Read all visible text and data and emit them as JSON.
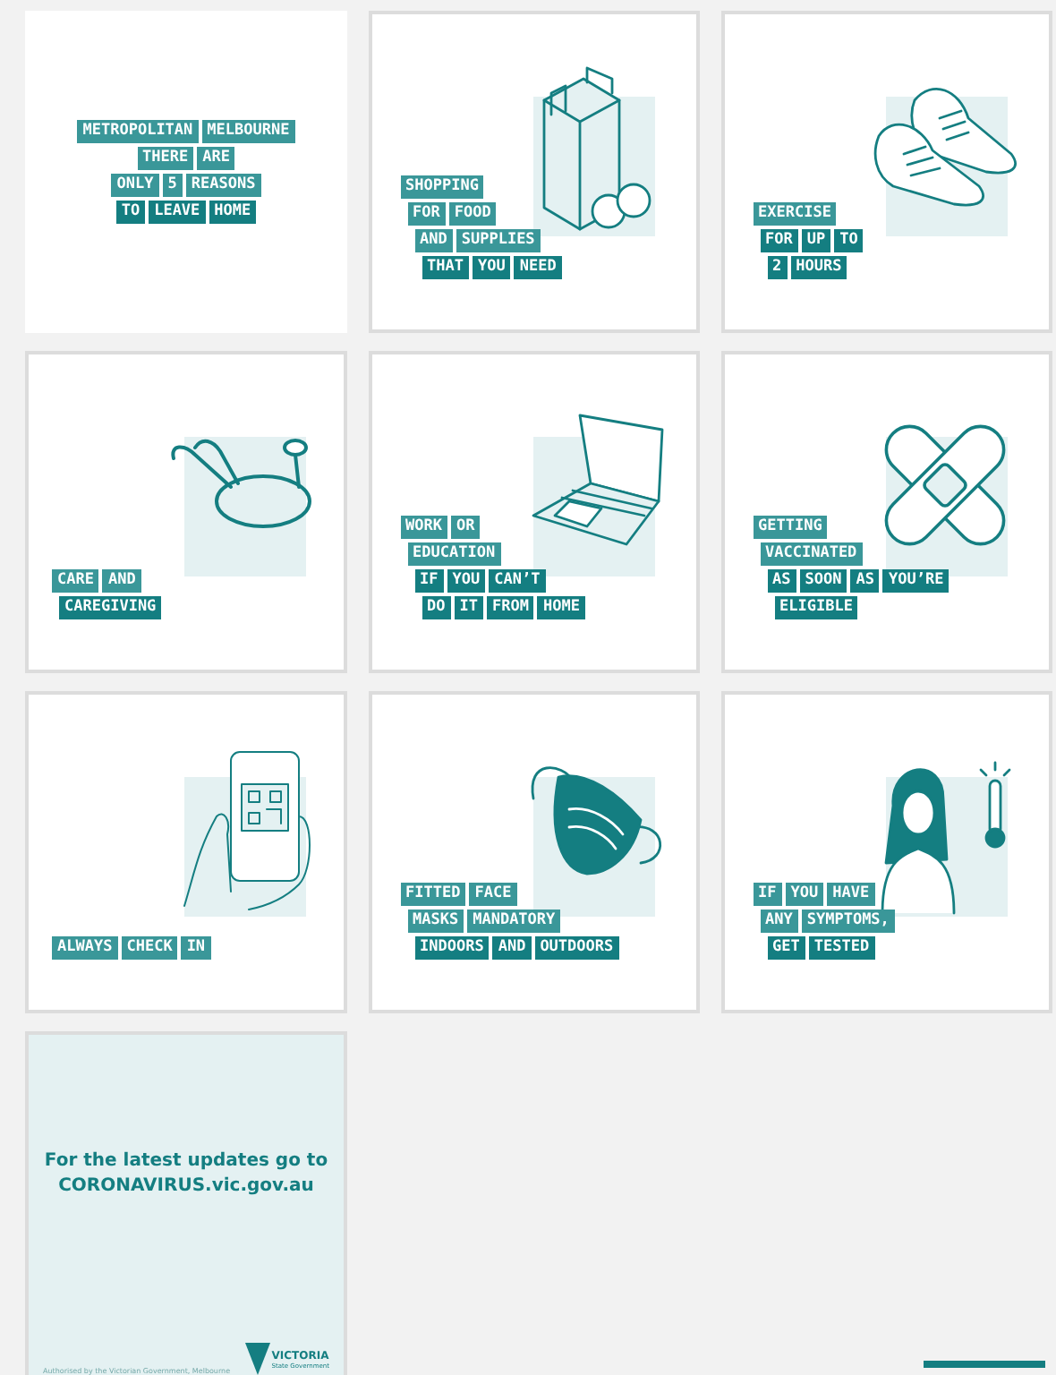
{
  "tiles": [
    {
      "kind": "text",
      "framed": false,
      "lines": [
        {
          "color": "#3a9799",
          "words": [
            "METROPOLITAN",
            "MELBOURNE"
          ]
        },
        {
          "color": "#3a9799",
          "words": [
            "THERE",
            "ARE"
          ]
        },
        {
          "color": "#3a9799",
          "words": [
            "ONLY",
            "5",
            "REASONS"
          ]
        },
        {
          "color": "#147e81",
          "words": [
            "TO",
            "LEAVE",
            "HOME"
          ]
        }
      ]
    },
    {
      "kind": "bag",
      "framed": true,
      "lines": [
        {
          "color": "#3a9799",
          "words": [
            "SHOPPING"
          ]
        },
        {
          "color": "#3a9799",
          "words": [
            "FOR",
            "FOOD"
          ]
        },
        {
          "color": "#3a9799",
          "words": [
            "AND",
            "SUPPLIES"
          ]
        },
        {
          "color": "#147e81",
          "words": [
            "THAT",
            "YOU",
            "NEED"
          ]
        }
      ]
    },
    {
      "kind": "shoes",
      "framed": true,
      "lines": [
        {
          "color": "#3a9799",
          "words": [
            "EXERCISE"
          ]
        },
        {
          "color": "#147e81",
          "words": [
            "FOR",
            "UP",
            "TO"
          ]
        },
        {
          "color": "#147e81",
          "words": [
            "2",
            "HOURS"
          ]
        }
      ]
    },
    {
      "kind": "stethoscope",
      "framed": true,
      "lines": [
        {
          "color": "#3a9799",
          "words": [
            "CARE",
            "AND"
          ]
        },
        {
          "color": "#147e81",
          "words": [
            "CAREGIVING"
          ]
        }
      ]
    },
    {
      "kind": "laptop",
      "framed": true,
      "lines": [
        {
          "color": "#3a9799",
          "words": [
            "WORK",
            "OR"
          ]
        },
        {
          "color": "#3a9799",
          "words": [
            "EDUCATION"
          ]
        },
        {
          "color": "#147e81",
          "words": [
            "IF",
            "YOU",
            "CAN’T"
          ]
        },
        {
          "color": "#147e81",
          "words": [
            "DO",
            "IT",
            "FROM",
            "HOME"
          ]
        }
      ]
    },
    {
      "kind": "bandage",
      "framed": true,
      "lines": [
        {
          "color": "#3a9799",
          "words": [
            "GETTING"
          ]
        },
        {
          "color": "#3a9799",
          "words": [
            "VACCINATED"
          ]
        },
        {
          "color": "#147e81",
          "words": [
            "AS",
            "SOON",
            "AS",
            "YOU’RE"
          ]
        },
        {
          "color": "#147e81",
          "words": [
            "ELIGIBLE"
          ]
        }
      ]
    },
    {
      "kind": "phone",
      "framed": true,
      "lines": [
        {
          "color": "#3a9799",
          "words": [
            "ALWAYS",
            "CHECK",
            "IN"
          ]
        }
      ]
    },
    {
      "kind": "mask",
      "framed": true,
      "lines": [
        {
          "color": "#3a9799",
          "words": [
            "FITTED",
            "FACE"
          ]
        },
        {
          "color": "#3a9799",
          "words": [
            "MASKS",
            "MANDATORY"
          ]
        },
        {
          "color": "#147e81",
          "words": [
            "INDOORS",
            "AND",
            "OUTDOORS"
          ]
        }
      ]
    },
    {
      "kind": "person",
      "framed": true,
      "lines": [
        {
          "color": "#3a9799",
          "words": [
            "IF",
            "YOU",
            "HAVE"
          ]
        },
        {
          "color": "#3a9799",
          "words": [
            "ANY",
            "SYMPTOMS,"
          ]
        },
        {
          "color": "#147e81",
          "words": [
            "GET",
            "TESTED"
          ]
        }
      ]
    }
  ],
  "footer_tile": {
    "message": "For the latest updates go to CORONAVIRUS.vic.gov.au",
    "authorisation": "Authorised by the Victorian Government, Melbourne",
    "logo_name": "VICTORIA",
    "logo_sub": "State Government"
  }
}
